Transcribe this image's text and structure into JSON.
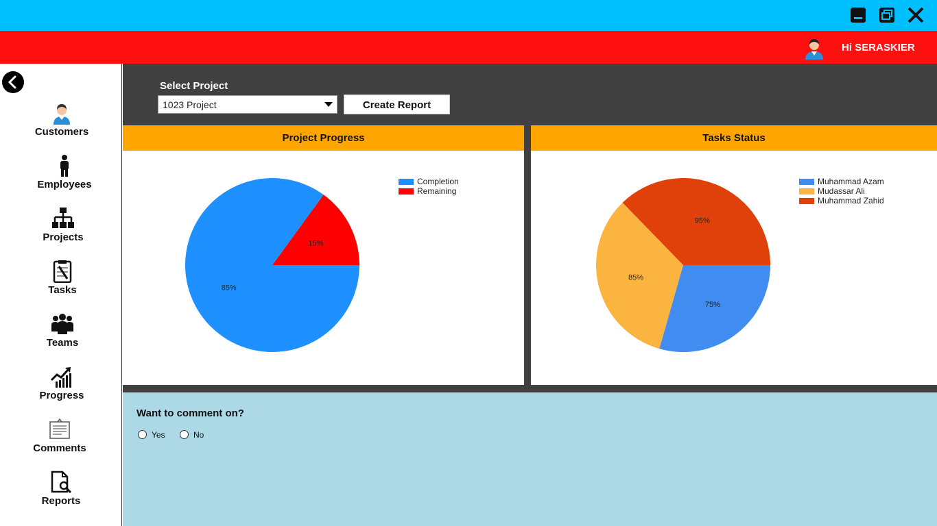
{
  "window": {
    "controls": [
      "minimize-icon",
      "restore-icon",
      "close-icon"
    ]
  },
  "header": {
    "greeting": "Hi SERASKIER",
    "avatar_icon": "user-avatar-icon"
  },
  "sidebar": {
    "back_icon": "back-arrow-icon",
    "items": [
      {
        "label": "Customers",
        "icon": "customer-icon"
      },
      {
        "label": "Employees",
        "icon": "employee-icon"
      },
      {
        "label": "Projects",
        "icon": "hierarchy-icon"
      },
      {
        "label": "Tasks",
        "icon": "clipboard-icon"
      },
      {
        "label": "Teams",
        "icon": "team-icon"
      },
      {
        "label": "Progress",
        "icon": "growth-chart-icon"
      },
      {
        "label": "Comments",
        "icon": "comment-board-icon"
      },
      {
        "label": "Reports",
        "icon": "report-search-icon"
      }
    ]
  },
  "toolbar": {
    "select_label": "Select Project",
    "selected_project": "1023 Project",
    "create_report_label": "Create Report"
  },
  "panels": {
    "progress_title": "Project Progress",
    "tasks_title": "Tasks Status"
  },
  "comment": {
    "question": "Want to comment on?",
    "options": [
      "Yes",
      "No"
    ]
  },
  "colors": {
    "titlebar": "#00bfff",
    "header": "#ff1010",
    "panel_header": "#ffa500",
    "dark_bg": "#404040",
    "comment_bg": "#add8e6"
  },
  "chart_data": [
    {
      "type": "pie",
      "title": "Project Progress",
      "labels": [
        "Completion",
        "Remaining"
      ],
      "values": [
        85,
        15
      ],
      "value_labels": [
        "85%",
        "15%"
      ],
      "colors": [
        "#1e90ff",
        "#ff0000"
      ],
      "legend": "top-right"
    },
    {
      "type": "pie",
      "title": "Tasks Status",
      "labels": [
        "Muhammad Azam",
        "Mudassar Ali",
        "Muhammad Zahid"
      ],
      "values": [
        75,
        85,
        95
      ],
      "value_labels": [
        "75%",
        "85%",
        "95%"
      ],
      "colors": [
        "#418cf0",
        "#fcb441",
        "#e0400a"
      ],
      "legend": "top-right"
    }
  ]
}
